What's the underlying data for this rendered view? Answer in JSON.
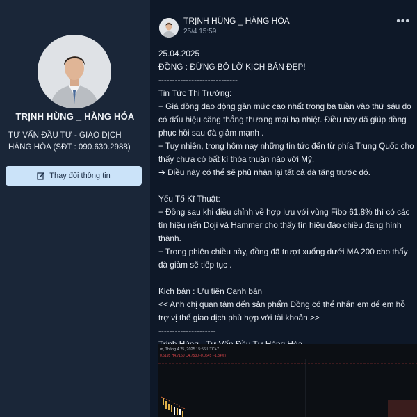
{
  "profile": {
    "name": "TRỊNH HÙNG _ HÀNG HÓA",
    "description": "TƯ VẤN ĐẦU TƯ - GIAO DỊCH HÀNG HÓA (SĐT : 090.630.2988)",
    "edit_button_label": "Thay đổi thông tin"
  },
  "post": {
    "author": "TRỊNH HÙNG _ HÀNG HÓA",
    "time": "25/4 15:59",
    "more_icon": "more-options-icon",
    "lines": [
      "25.04.2025",
      "ĐỒNG : ĐỪNG BỎ LỠ KỊCH BẢN ĐẸP!",
      "-----------------------------",
      "Tin Tức Thị Trường:",
      "+ Giá đồng dao động gần mức cao nhất trong ba tuần vào thứ sáu do có dấu hiệu căng thẳng thương mại hạ nhiệt. Điều này đã giúp đồng phục hồi sau đà giảm mạnh .",
      "+ Tuy nhiên, trong hôm nay những tin tức đến từ phía Trung Quốc cho thấy chưa có bất kì thỏa thuận nào với Mỹ.",
      "➔ Điều này có thể sẽ phủ nhận lại tất cả đà tăng trước đó.",
      "",
      "Yếu Tố Kĩ Thuật:",
      "+ Đồng sau khi điều chỉnh về hợp lưu với vùng Fibo 61.8% thì có các tín hiệu nến Doji và Hammer cho thấy tín hiệu đảo chiều đang hình thành.",
      "+ Trong phiên chiều này, đồng đã trượt xuống dưới MA 200 cho thấy đà giảm sẽ tiếp tục .",
      "",
      "Kịch bản : Ưu tiên Canh bán",
      "<< Anh chị quan tâm đến sản phẩm Đồng có thể nhắn em để em hỗ trợ vị thế giao dịch phù hợp với tài khoản >>",
      "---------------------",
      "Trịnh Hùng - Tư Vấn Đầu Tư Hàng Hóa"
    ],
    "chart_thumb": {
      "header": "m, Tháng 4 25, 2025 15:56 UTC+7",
      "ohlc": "0.6195  H4.7160  C4.7530  -0.0645 (-1.34%)"
    }
  },
  "colors": {
    "background": "#0e1828",
    "sidebar": "#1a2638",
    "button": "#cbe3f9"
  }
}
